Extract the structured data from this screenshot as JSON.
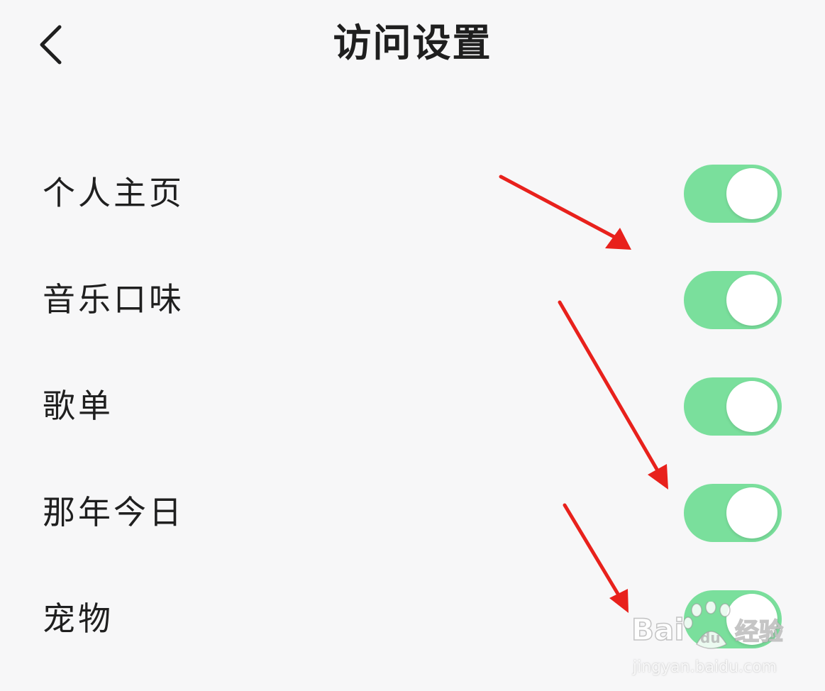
{
  "header": {
    "title": "访问设置",
    "back_icon": "chevron-left-icon"
  },
  "colors": {
    "toggle_on": "#7adf9c",
    "background": "#f7f7f8",
    "arrow": "#e8211c"
  },
  "settings": [
    {
      "label": "个人主页",
      "enabled": true
    },
    {
      "label": "音乐口味",
      "enabled": true
    },
    {
      "label": "歌单",
      "enabled": true
    },
    {
      "label": "那年今日",
      "enabled": true
    },
    {
      "label": "宠物",
      "enabled": true
    }
  ],
  "watermark": {
    "brand": "Baidu经验",
    "url": "jingyan.baidu.com"
  }
}
